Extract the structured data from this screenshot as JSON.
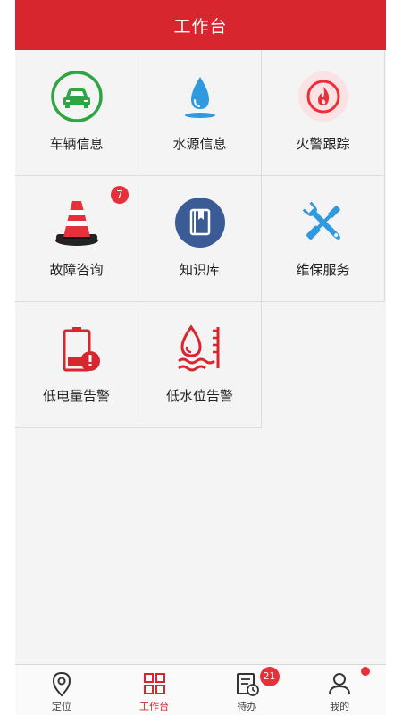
{
  "header": {
    "title": "工作台"
  },
  "colors": {
    "primary": "#d8262f",
    "green": "#2ea443",
    "blue": "#2f9ae0",
    "navy": "#3b5b96",
    "badge": "#e8303a"
  },
  "grid": {
    "items": [
      {
        "label": "车辆信息",
        "icon": "car-icon"
      },
      {
        "label": "水源信息",
        "icon": "water-drop-icon"
      },
      {
        "label": "火警跟踪",
        "icon": "fire-icon"
      },
      {
        "label": "故障咨询",
        "icon": "traffic-cone-icon",
        "badge": "7"
      },
      {
        "label": "知识库",
        "icon": "book-icon"
      },
      {
        "label": "维保服务",
        "icon": "tools-icon"
      },
      {
        "label": "低电量告警",
        "icon": "low-battery-icon"
      },
      {
        "label": "低水位告警",
        "icon": "low-water-level-icon"
      }
    ]
  },
  "tabbar": {
    "items": [
      {
        "label": "定位",
        "icon": "location-pin-icon"
      },
      {
        "label": "工作台",
        "icon": "grid-icon",
        "active": true
      },
      {
        "label": "待办",
        "icon": "todo-list-icon",
        "badge": "21"
      },
      {
        "label": "我的",
        "icon": "user-icon",
        "dot": true
      }
    ]
  }
}
